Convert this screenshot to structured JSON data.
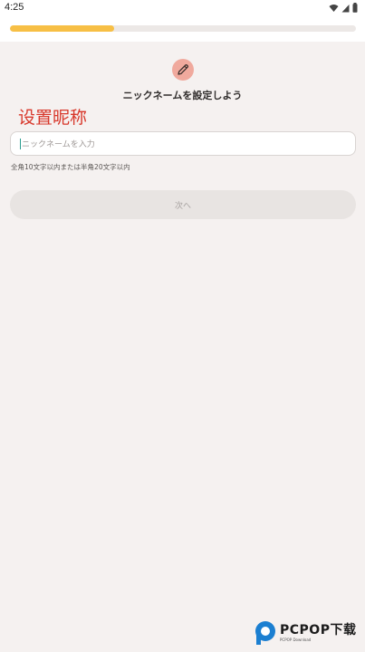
{
  "status_bar": {
    "time": "4:25",
    "icons": [
      "wifi-icon",
      "signal-icon",
      "battery-icon"
    ]
  },
  "progress": {
    "fraction": 0.3
  },
  "form": {
    "icon": "pencil-icon",
    "title": "ニックネームを設定しよう",
    "caption": "设置昵称",
    "input_value": "",
    "input_placeholder": "ニックネームを入力",
    "hint": "全角10文字以内または半角20文字以内",
    "next_label": "次へ"
  },
  "watermark": {
    "name": "PCPOP下载",
    "sub": "PCPOP Download"
  },
  "colors": {
    "background": "#f5f1f0",
    "progress_fill": "#f7bf45",
    "icon_circle": "#f0a99d",
    "caption_red": "#d8372a",
    "caret": "#2a9d8f"
  }
}
